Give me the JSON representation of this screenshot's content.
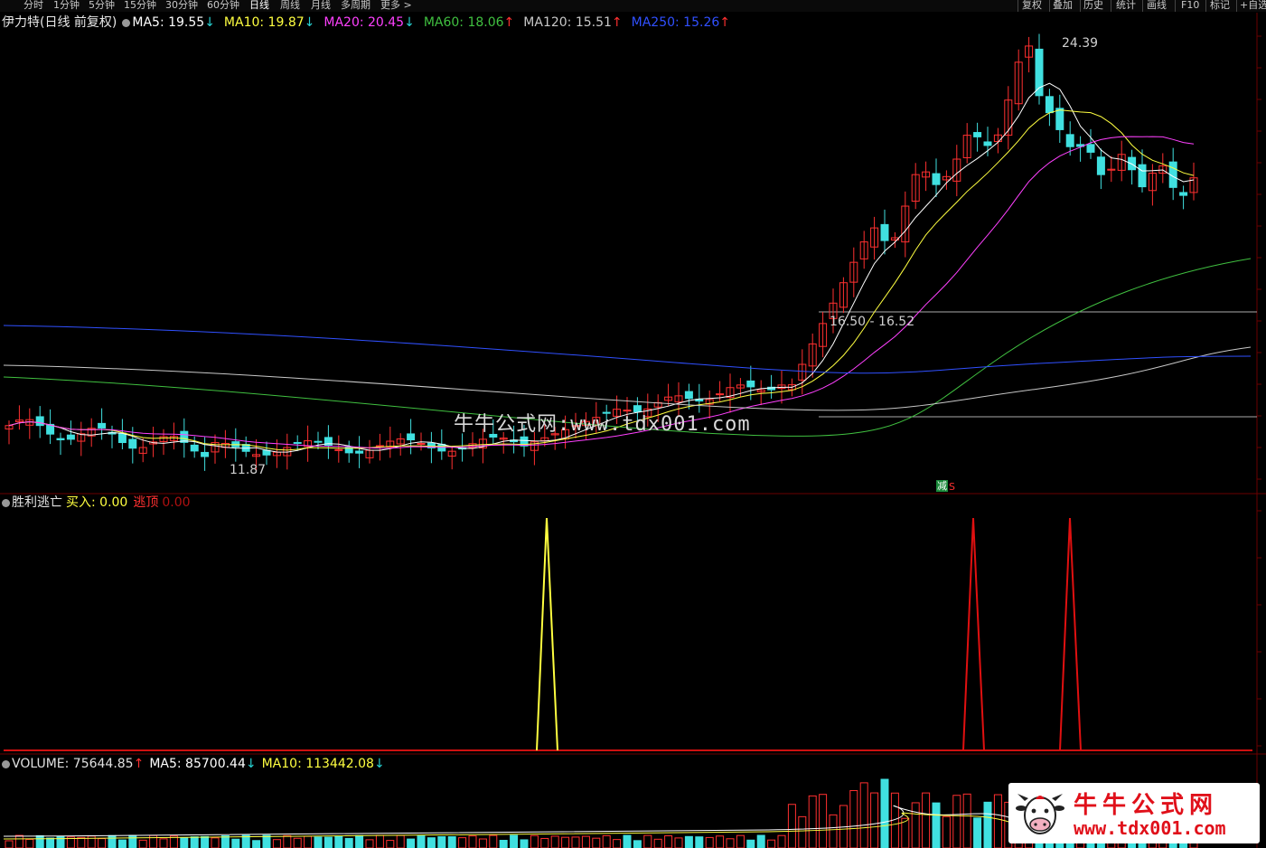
{
  "toolbar": {
    "timeframes": [
      {
        "label": "分时"
      },
      {
        "label": "1分钟"
      },
      {
        "label": "5分钟"
      },
      {
        "label": "15分钟"
      },
      {
        "label": "30分钟"
      },
      {
        "label": "60分钟"
      },
      {
        "label": "日线"
      },
      {
        "label": "周线"
      },
      {
        "label": "月线"
      },
      {
        "label": "多周期"
      },
      {
        "label": "更多 >"
      }
    ],
    "active_timeframe": "日线",
    "right_buttons": [
      {
        "label": "复权"
      },
      {
        "label": "叠加"
      },
      {
        "label": "历史"
      },
      {
        "label": "统计"
      },
      {
        "label": "画线"
      },
      {
        "label": "F10"
      },
      {
        "label": "标记"
      },
      {
        "label": "+自选"
      }
    ]
  },
  "main_panel": {
    "title": "伊力特(日线 前复权)",
    "ma": [
      {
        "label": "MA5: 19.55",
        "arrow": "↓",
        "color": "#ffffff"
      },
      {
        "label": "MA10: 19.87",
        "arrow": "↓",
        "color": "#ffff40"
      },
      {
        "label": "MA20: 20.45",
        "arrow": "↓",
        "color": "#ff40ff"
      },
      {
        "label": "MA60: 18.06",
        "arrow": "↑",
        "color": "#40c040"
      },
      {
        "label": "MA120: 15.51",
        "arrow": "↑",
        "color": "#c8c8c8"
      },
      {
        "label": "MA250: 15.26",
        "arrow": "↑",
        "color": "#3050ff"
      }
    ],
    "high_label": "24.39",
    "low_label": "11.87",
    "range_label": "16.50 - 16.52",
    "reduce_label": "减",
    "s_label": "S",
    "up_color": "#ff3030",
    "down_color": "#40e0e0"
  },
  "indicator_panel": {
    "name": "胜利逃亡",
    "buy": "买入: 0.00",
    "escape_label": "逃顶",
    "escape_value": "0.00"
  },
  "volume_panel": {
    "volume": "VOLUME: 75644.85",
    "volume_arrow": "↑",
    "ma5": "MA5: 85700.44",
    "ma5_arrow": "↓",
    "ma10": "MA10: 113442.08",
    "ma10_arrow": "↓"
  },
  "watermark": "牛牛公式网:www.tdx001.com",
  "logo": {
    "name": "牛牛公式网",
    "url": "www.tdx001.com"
  }
}
